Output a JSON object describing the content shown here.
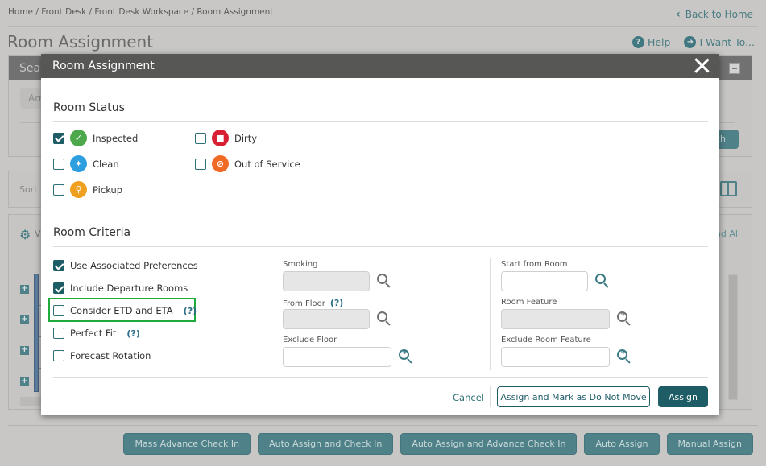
{
  "breadcrumb": "Home / Front Desk / Front Desk Workspace / Room Assignment",
  "back_to_home": "Back to Home",
  "page_title": "Room Assignment",
  "top_actions": {
    "help": "Help",
    "i_want_to": "I Want To..."
  },
  "background": {
    "search_header": "Search",
    "arrivals_tab": "Arr",
    "search_button": "Search",
    "sort_label": "Sort",
    "view_label": "V",
    "expand_all": "Expand All"
  },
  "bottom_actions": [
    "Mass Advance Check In",
    "Auto Assign and Check In",
    "Auto Assign and Advance Check In",
    "Auto Assign",
    "Manual Assign"
  ],
  "modal": {
    "title": "Room Assignment",
    "room_status": {
      "title": "Room Status",
      "items": [
        {
          "label": "Inspected",
          "checked": true,
          "icon": "clipboard-check-icon",
          "color": "#4ca84a"
        },
        {
          "label": "Clean",
          "checked": false,
          "icon": "sparkle-icon",
          "color": "#2d9fe0"
        },
        {
          "label": "Pickup",
          "checked": false,
          "icon": "trash-search-icon",
          "color": "#f0a020"
        },
        {
          "label": "Dirty",
          "checked": false,
          "icon": "trash-can-icon",
          "color": "#d81f34"
        },
        {
          "label": "Out of Service",
          "checked": false,
          "icon": "out-of-service-icon",
          "color": "#ef6a25"
        }
      ]
    },
    "room_criteria": {
      "title": "Room Criteria",
      "checkboxes": [
        {
          "label": "Use Associated Preferences",
          "checked": true,
          "help": false
        },
        {
          "label": "Include Departure Rooms",
          "checked": true,
          "help": false
        },
        {
          "label": "Consider ETD and ETA",
          "checked": false,
          "help": true,
          "highlighted": true
        },
        {
          "label": "Perfect Fit",
          "checked": false,
          "help": true
        },
        {
          "label": "Forecast Rotation",
          "checked": false,
          "help": false
        }
      ],
      "help_marker": "(?)",
      "fields": {
        "smoking": {
          "label": "Smoking",
          "value": "",
          "disabled": true
        },
        "from_floor": {
          "label": "From Floor",
          "value": "",
          "disabled": true,
          "help": true
        },
        "exclude_floor": {
          "label": "Exclude Floor",
          "value": "",
          "disabled": false
        },
        "start_from_room": {
          "label": "Start from Room",
          "value": "",
          "disabled": false
        },
        "room_feature": {
          "label": "Room Feature",
          "value": "",
          "disabled": true
        },
        "exclude_room_feature": {
          "label": "Exclude Room Feature",
          "value": "",
          "disabled": false
        }
      }
    },
    "footer": {
      "cancel": "Cancel",
      "assign_do_not_move": "Assign and Mark as Do Not Move",
      "assign": "Assign"
    }
  }
}
